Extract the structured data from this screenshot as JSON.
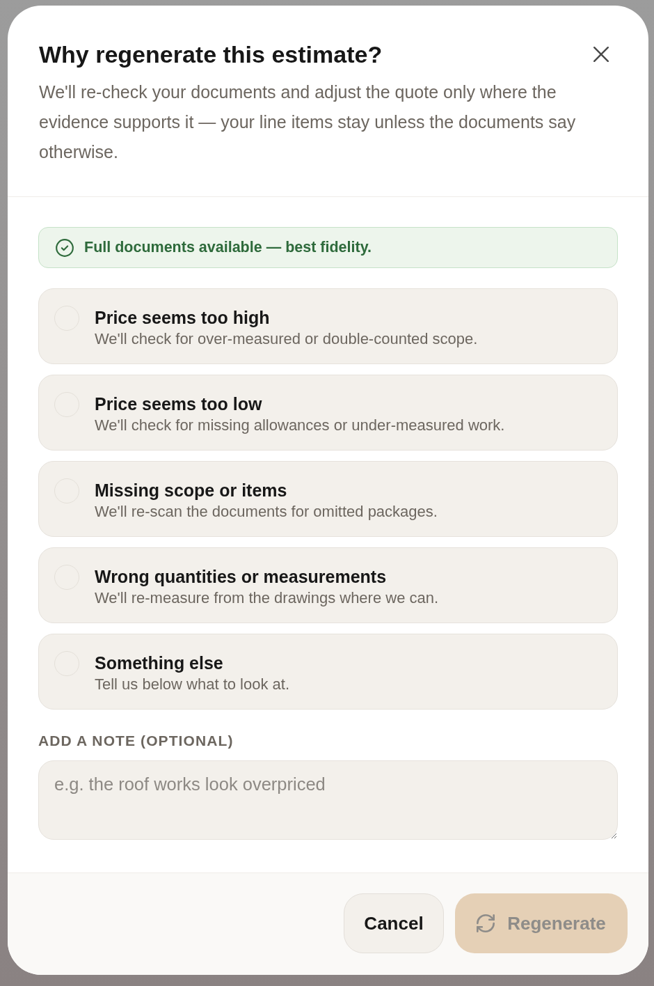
{
  "dialog": {
    "title": "Why regenerate this estimate?",
    "description": "We'll re-check your documents and adjust the quote only where the evidence supports it — your line items stay unless the documents say otherwise."
  },
  "banner": {
    "kind": "success",
    "text": "Full documents available — best fidelity."
  },
  "options": [
    {
      "title": "Price seems too high",
      "description": "We'll check for over-measured or double-counted scope.",
      "selected": false
    },
    {
      "title": "Price seems too low",
      "description": "We'll check for missing allowances or under-measured work.",
      "selected": false
    },
    {
      "title": "Missing scope or items",
      "description": "We'll re-scan the documents for omitted packages.",
      "selected": false
    },
    {
      "title": "Wrong quantities or measurements",
      "description": "We'll re-measure from the drawings where we can.",
      "selected": false
    },
    {
      "title": "Something else",
      "description": "Tell us below what to look at.",
      "selected": false
    }
  ],
  "note": {
    "label": "ADD A NOTE (OPTIONAL)",
    "placeholder": "e.g. the roof works look overpriced"
  },
  "buttons": [
    {
      "kind": "secondary",
      "label": "Cancel",
      "disabled": false
    },
    {
      "kind": "primary",
      "label": "Regenerate",
      "disabled": true
    }
  ]
}
